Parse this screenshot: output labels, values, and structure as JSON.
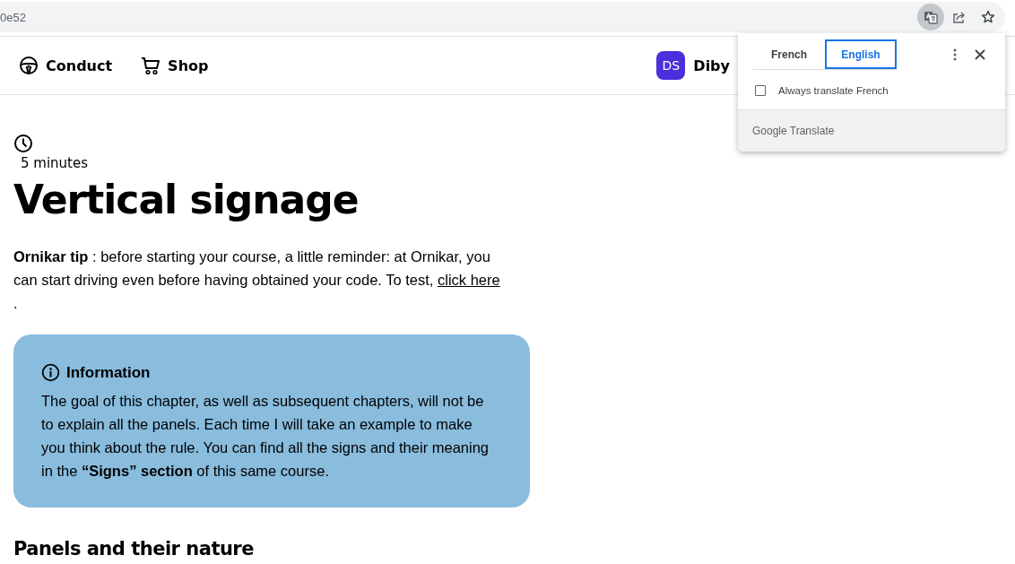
{
  "address_bar": {
    "url": "0e52"
  },
  "nav": {
    "items": [
      {
        "kind": "wheel",
        "label": "Conduct"
      },
      {
        "kind": "cart",
        "label": "Shop"
      }
    ],
    "user": {
      "initials": "DS",
      "name": "Diby"
    }
  },
  "translate_popup": {
    "tabs": [
      {
        "label": "French",
        "selected": false
      },
      {
        "label": "English",
        "selected": true
      }
    ],
    "always_translate": {
      "label": "Always translate French",
      "checked": false
    },
    "footer": "Google Translate"
  },
  "article": {
    "duration": "5 minutes",
    "title": "Vertical signage",
    "tip": {
      "text": "**Ornikar tip** : before starting your course, a little reminder: at Ornikar, you can start driving even before having obtained your code. To test, ",
      "link": "click here",
      "tail": " ."
    },
    "info": {
      "title": "Information",
      "text": "The goal of this chapter, as well as subsequent chapters, will not be to explain all the panels. Each time I will take an example to make you think about the rule. You can find all the signs and their meaning in the **“Signs” section** of this same course."
    },
    "section_title": "Panels and their nature"
  }
}
